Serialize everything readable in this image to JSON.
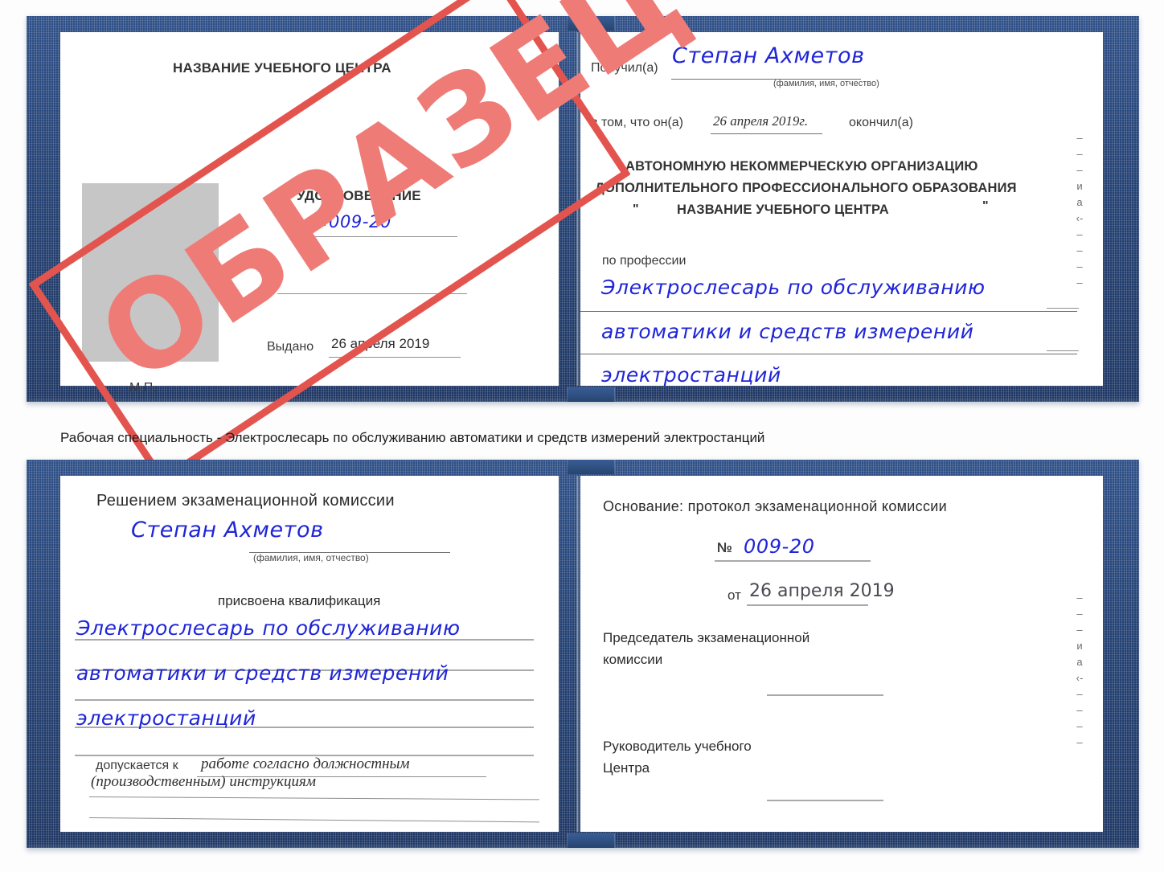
{
  "document": {
    "kind": "удостоверение",
    "watermark": "ОБРАЗЕЦ"
  },
  "cert_top": {
    "left_page": {
      "org_title": "НАЗВАНИЕ УЧЕБНОГО ЦЕНТРА",
      "doc_title": "УДОСТОВЕРЕНИЕ",
      "number_label": "№",
      "number_value": "009-20",
      "issued_label": "Выдано",
      "issued_value": "26 апреля 2019",
      "seal_label": "М.П.",
      "photo_placeholder": "photo-placeholder"
    },
    "right_page": {
      "received_label": "Получил(а)",
      "received_value": "Степан Ахметов",
      "name_hint": "(фамилия, имя, отчество)",
      "that_he_label": "в том, что он(а)",
      "finish_date": "26 апреля 2019г.",
      "finished_label": "окончил(а)",
      "org_line1": "АВТОНОМНУЮ НЕКОММЕРЧЕСКУЮ ОРГАНИЗАЦИЮ",
      "org_line2": "ДОПОЛНИТЕЛЬНОГО ПРОФЕССИОНАЛЬНОГО ОБРАЗОВАНИЯ",
      "org_quote_open": "\"",
      "org_line3": "НАЗВАНИЕ УЧЕБНОГО ЦЕНТРА",
      "org_quote_close": "\"",
      "profession_label": "по профессии",
      "profession_line1": "Электрослесарь по обслуживанию",
      "profession_line2": "автоматики и средств измерений",
      "profession_line3": "электростанций",
      "edge_column": "–\n–\n–\nи\nа\n‹-\n–\n–\n–\n–"
    }
  },
  "caption": "Рабочая специальность - Электрослесарь по обслуживанию автоматики и средств измерений электростанций",
  "cert_bottom": {
    "left_page": {
      "heading": "Решением экзаменационной комиссии",
      "name_value": "Степан Ахметов",
      "name_hint": "(фамилия, имя, отчество)",
      "qualification_label": "присвоена квалификация",
      "qualification_line1": "Электрослесарь по обслуживанию",
      "qualification_line2": "автоматики и средств измерений",
      "qualification_line3": "электростанций",
      "allowed_label": "допускается к",
      "allowed_line1": "работе согласно должностным",
      "allowed_line2": "(производственным) инструкциям"
    },
    "right_page": {
      "basis_label": "Основание: протокол экзаменационной комиссии",
      "number_label": "№",
      "number_value": "009-20",
      "date_label": "от",
      "date_value": "26 апреля 2019",
      "chairman_line1": "Председатель экзаменационной",
      "chairman_line2": "комиссии",
      "head_line1": "Руководитель учебного",
      "head_line2": "Центра",
      "edge_column": "–\n–\n–\nи\nа\n‹-\n–\n–\n–\n–"
    }
  },
  "colors": {
    "cover_blue": "#234072",
    "handwriting_blue": "#1f25d8",
    "stamp_red": "#e4544e",
    "stamp_fill": "#ef7b77",
    "photo_gray": "#c6c6c6",
    "rule_gray": "#8e8e8e"
  }
}
